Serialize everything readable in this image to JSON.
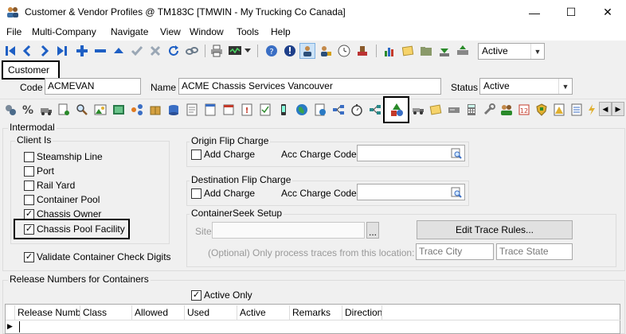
{
  "window": {
    "title": "Customer & Vendor Profiles @ TM183C [TMWIN - My Trucking Co Canada]",
    "minimize": "—",
    "maximize": "☐",
    "close": "✕"
  },
  "menu": [
    "File",
    "Multi-Company",
    "Navigate",
    "View",
    "Window",
    "Tools",
    "Help"
  ],
  "toolbar": {
    "status_filter": "Active",
    "dropdown_arrow": "▼"
  },
  "tab_label": "Customer",
  "header": {
    "code_label": "Code",
    "code_value": "ACMEVAN",
    "name_label": "Name",
    "name_value": "ACME Chassis Services Vancouver",
    "status_label": "Status",
    "status_value": "Active"
  },
  "intermodal": {
    "title": "Intermodal",
    "client_is": {
      "title": "Client Is",
      "items": [
        {
          "label": "Steamship Line",
          "checked": false
        },
        {
          "label": "Port",
          "checked": false
        },
        {
          "label": "Rail Yard",
          "checked": false
        },
        {
          "label": "Container Pool",
          "checked": false
        },
        {
          "label": "Chassis Owner",
          "checked": true
        },
        {
          "label": "Chassis Pool Facility",
          "checked": true
        }
      ]
    },
    "validate_label": "Validate Container Check Digits",
    "origin_flip": {
      "title": "Origin Flip Charge",
      "add_charge": "Add Charge",
      "acc_code_label": "Acc Charge Code"
    },
    "dest_flip": {
      "title": "Destination Flip Charge",
      "add_charge": "Add Charge",
      "acc_code_label": "Acc Charge Code"
    },
    "containerseek": {
      "title": "ContainerSeek Setup",
      "site_label": "Site",
      "browse": "...",
      "edit_trace_button": "Edit Trace Rules...",
      "optional_text": "(Optional) Only process traces from this location:",
      "trace_city_placeholder": "Trace City",
      "trace_state_placeholder": "Trace State"
    }
  },
  "release": {
    "title": "Release Numbers for Containers",
    "active_only": "Active Only",
    "columns": [
      "Release Numb",
      "Class",
      "Allowed",
      "Used",
      "Active",
      "Remarks",
      "Direction"
    ],
    "row_marker": "▶"
  },
  "colors": {
    "nav_blue": "#1e5fc4",
    "highlight": "#000000"
  }
}
